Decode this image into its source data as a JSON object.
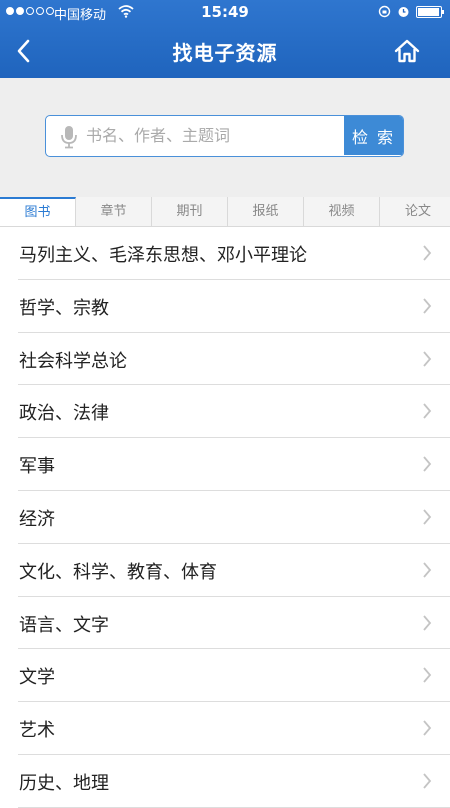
{
  "status_bar": {
    "carrier": "中国移动",
    "time": "15:49",
    "battery_level": 0.95
  },
  "nav": {
    "title": "找电子资源",
    "back_icon": "chevron-left-icon",
    "home_icon": "home-icon"
  },
  "search": {
    "placeholder": "书名、作者、主题词",
    "value": "",
    "button_label": "检 索",
    "mic_icon": "microphone-icon"
  },
  "tabs": [
    {
      "label": "图书",
      "active": true
    },
    {
      "label": "章节",
      "active": false
    },
    {
      "label": "期刊",
      "active": false
    },
    {
      "label": "报纸",
      "active": false
    },
    {
      "label": "视频",
      "active": false
    },
    {
      "label": "论文",
      "active": false
    }
  ],
  "categories": [
    {
      "label": "马列主义、毛泽东思想、邓小平理论"
    },
    {
      "label": "哲学、宗教"
    },
    {
      "label": "社会科学总论"
    },
    {
      "label": "政治、法律"
    },
    {
      "label": "军事"
    },
    {
      "label": "经济"
    },
    {
      "label": "文化、科学、教育、体育"
    },
    {
      "label": "语言、文字"
    },
    {
      "label": "文学"
    },
    {
      "label": "艺术"
    },
    {
      "label": "历史、地理"
    }
  ],
  "colors": {
    "brand_blue": "#2b7bd3",
    "search_button": "#3d8ad6",
    "background_gray": "#eeeeee"
  }
}
